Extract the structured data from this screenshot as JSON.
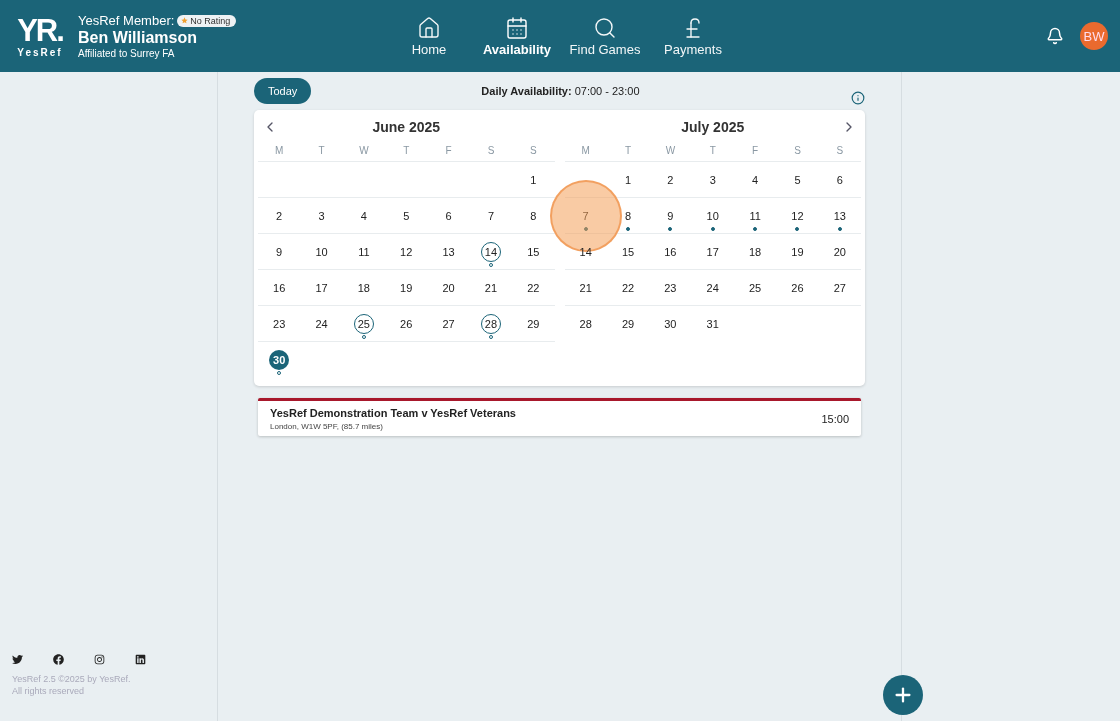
{
  "header": {
    "logo": {
      "mark": "YR.",
      "word": "YesRef"
    },
    "member_label": "YesRef Member:",
    "rating": "No Rating",
    "name": "Ben Williamson",
    "affiliation": "Affiliated to Surrey FA",
    "nav": [
      {
        "label": "Home",
        "kind": "home",
        "selected": false
      },
      {
        "label": "Availability",
        "kind": "calendar",
        "selected": true
      },
      {
        "label": "Find Games",
        "kind": "search",
        "selected": false
      },
      {
        "label": "Payments",
        "kind": "pound",
        "selected": false
      }
    ],
    "avatar": "BW"
  },
  "sidebar": {
    "version": "YesRef 2.5 ©2025 by YesRef.",
    "rights": "All rights reserved"
  },
  "toolbar": {
    "today": "Today",
    "availability_label": "Daily Availability:",
    "availability_value": "07:00 - 23:00"
  },
  "months": [
    {
      "title": "June 2025",
      "weekdays": [
        "M",
        "T",
        "W",
        "T",
        "F",
        "S",
        "S"
      ],
      "weeks": [
        {
          "kind": "leading",
          "days": [
            {
              "label": "1"
            }
          ]
        },
        {
          "days": [
            {
              "label": "2"
            },
            {
              "label": "3"
            },
            {
              "label": "4"
            },
            {
              "label": "5"
            },
            {
              "label": "6"
            },
            {
              "label": "7"
            },
            {
              "label": "8"
            }
          ]
        },
        {
          "days": [
            {
              "label": "9"
            },
            {
              "label": "10"
            },
            {
              "label": "11"
            },
            {
              "label": "12"
            },
            {
              "label": "13"
            },
            {
              "label": "14",
              "ringed": true,
              "dot": true,
              "filled": false
            },
            {
              "label": "15"
            }
          ]
        },
        {
          "days": [
            {
              "label": "16"
            },
            {
              "label": "17"
            },
            {
              "label": "18"
            },
            {
              "label": "19"
            },
            {
              "label": "20"
            },
            {
              "label": "21"
            },
            {
              "label": "22"
            }
          ]
        },
        {
          "days": [
            {
              "label": "23"
            },
            {
              "label": "24"
            },
            {
              "label": "25",
              "ringed": true,
              "dot": true,
              "filled": false
            },
            {
              "label": "26"
            },
            {
              "label": "27"
            },
            {
              "label": "28",
              "ringed": true,
              "dot": true,
              "filled": false
            },
            {
              "label": "29"
            }
          ]
        },
        {
          "days": [
            {
              "label": "30",
              "selected": true,
              "dot": true,
              "filled": false
            }
          ]
        }
      ]
    },
    {
      "title": "July 2025",
      "weekdays": [
        "M",
        "T",
        "W",
        "T",
        "F",
        "S",
        "S"
      ],
      "weeks": [
        {
          "kind": "leading",
          "days": [
            {
              "label": "1"
            },
            {
              "label": "2"
            },
            {
              "label": "3"
            },
            {
              "label": "4"
            },
            {
              "label": "5"
            },
            {
              "label": "6"
            }
          ]
        },
        {
          "days": [
            {
              "label": "7",
              "dot": true,
              "filled": true,
              "pressed": true
            },
            {
              "label": "8",
              "dot": true,
              "filled": true
            },
            {
              "label": "9",
              "dot": true,
              "filled": true
            },
            {
              "label": "10",
              "dot": true,
              "filled": true
            },
            {
              "label": "11",
              "dot": true,
              "filled": true
            },
            {
              "label": "12",
              "dot": true,
              "filled": true
            },
            {
              "label": "13",
              "dot": true,
              "filled": true
            }
          ]
        },
        {
          "days": [
            {
              "label": "14"
            },
            {
              "label": "15"
            },
            {
              "label": "16"
            },
            {
              "label": "17"
            },
            {
              "label": "18"
            },
            {
              "label": "19"
            },
            {
              "label": "20"
            }
          ]
        },
        {
          "days": [
            {
              "label": "21"
            },
            {
              "label": "22"
            },
            {
              "label": "23"
            },
            {
              "label": "24"
            },
            {
              "label": "25"
            },
            {
              "label": "26"
            },
            {
              "label": "27"
            }
          ]
        },
        {
          "days": [
            {
              "label": "28"
            },
            {
              "label": "29"
            },
            {
              "label": "30"
            },
            {
              "label": "31"
            }
          ]
        }
      ]
    }
  ],
  "events": [
    {
      "title": "YesRef Demonstration Team v YesRef Veterans",
      "location": "London, W1W 5PF, (85.7 miles)",
      "time": "15:00",
      "color": "#a8182c"
    }
  ]
}
